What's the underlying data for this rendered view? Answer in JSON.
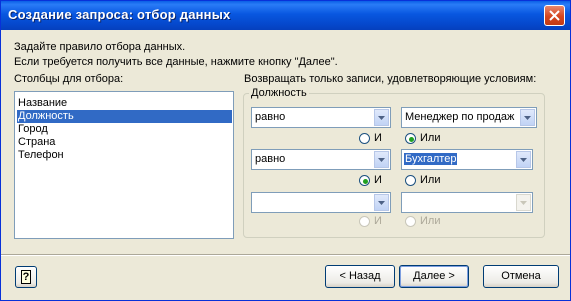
{
  "window": {
    "title": "Создание запроса: отбор данных"
  },
  "intro": {
    "line1": "Задайте правило отбора данных.",
    "line2": "Если требуется получить все данные, нажмите кнопку \"Далее\"."
  },
  "columns": {
    "label": "Столбцы для отбора:",
    "items": [
      "Название",
      "Должность",
      "Город",
      "Страна",
      "Телефон"
    ],
    "selected_index": 1
  },
  "conditions": {
    "label": "Возвращать только записи, удовлетворяющие условиям:",
    "group_title": "Должность",
    "rows": [
      {
        "operator": "равно",
        "value": "Менеджер по продаж"
      },
      {
        "operator": "равно",
        "value": "Бухгалтер"
      },
      {
        "operator": "",
        "value": ""
      }
    ],
    "logic": [
      {
        "and_label": "И",
        "or_label": "Или",
        "selected": "or"
      },
      {
        "and_label": "И",
        "or_label": "Или",
        "selected": "and"
      },
      {
        "and_label": "И",
        "or_label": "Или",
        "selected": "none",
        "disabled": true
      }
    ]
  },
  "buttons": {
    "help": "?",
    "back": "< Назад",
    "next": "Далее >",
    "cancel": "Отмена"
  },
  "colors": {
    "titlebar": "#0a5fe6",
    "selection": "#316ac5",
    "dialog_bg": "#ece9d8",
    "radio_dot": "#21a121"
  }
}
